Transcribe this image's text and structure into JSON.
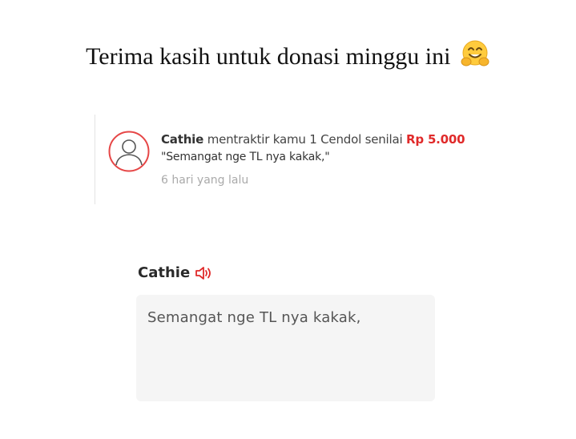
{
  "title": {
    "text": "Terima kasih untuk donasi minggu ini",
    "emoji_icon": "hugging-face-icon"
  },
  "donation_card": {
    "avatar_icon": "user-avatar-icon",
    "sender": "Cathie",
    "action_text": "mentraktir kamu 1 Cendol senilai",
    "amount": "Rp 5.000",
    "message": "\"Semangat nge TL nya kakak,\"",
    "time": "6 hari yang lalu"
  },
  "tts_display": {
    "sender": "Cathie",
    "speaker_icon": "speaker-sound-icon",
    "message": "Semangat nge TL nya kakak,"
  },
  "colors": {
    "accent_red": "#e02a2a",
    "message_bg": "#f5f5f5"
  }
}
